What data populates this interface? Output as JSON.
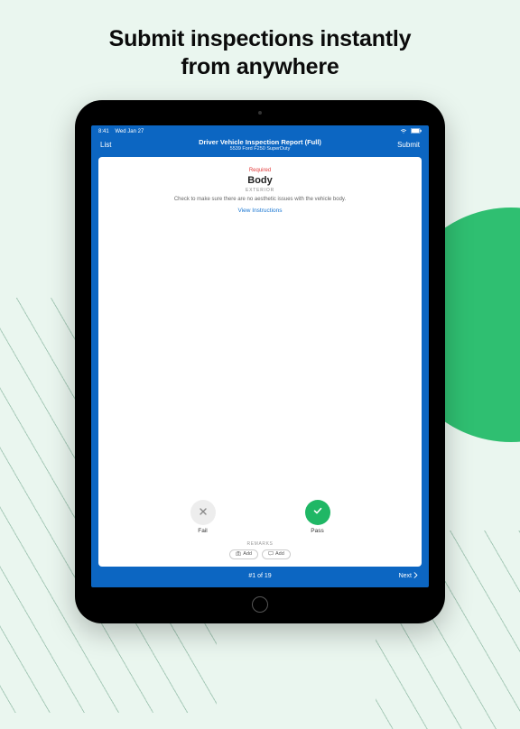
{
  "headline_line1": "Submit inspections instantly",
  "headline_line2": "from anywhere",
  "status": {
    "time": "8:41",
    "date": "Wed Jan 27",
    "wifi": "wifi",
    "battery": "100%"
  },
  "nav": {
    "back": "List",
    "title": "Driver Vehicle Inspection Report (Full)",
    "subtitle": "5539 Ford F250 SuperDuty",
    "submit": "Submit"
  },
  "item": {
    "required": "Required",
    "title": "Body",
    "category": "EXTERIOR",
    "description": "Check to make sure there are no aesthetic issues with the vehicle body.",
    "view_instructions": "View Instructions"
  },
  "passfail": {
    "fail_label": "Fail",
    "pass_label": "Pass"
  },
  "remarks": {
    "label": "REMARKS",
    "add_photo": "Add",
    "add_remark": "Add"
  },
  "footer": {
    "progress": "#1 of 19",
    "next": "Next"
  }
}
